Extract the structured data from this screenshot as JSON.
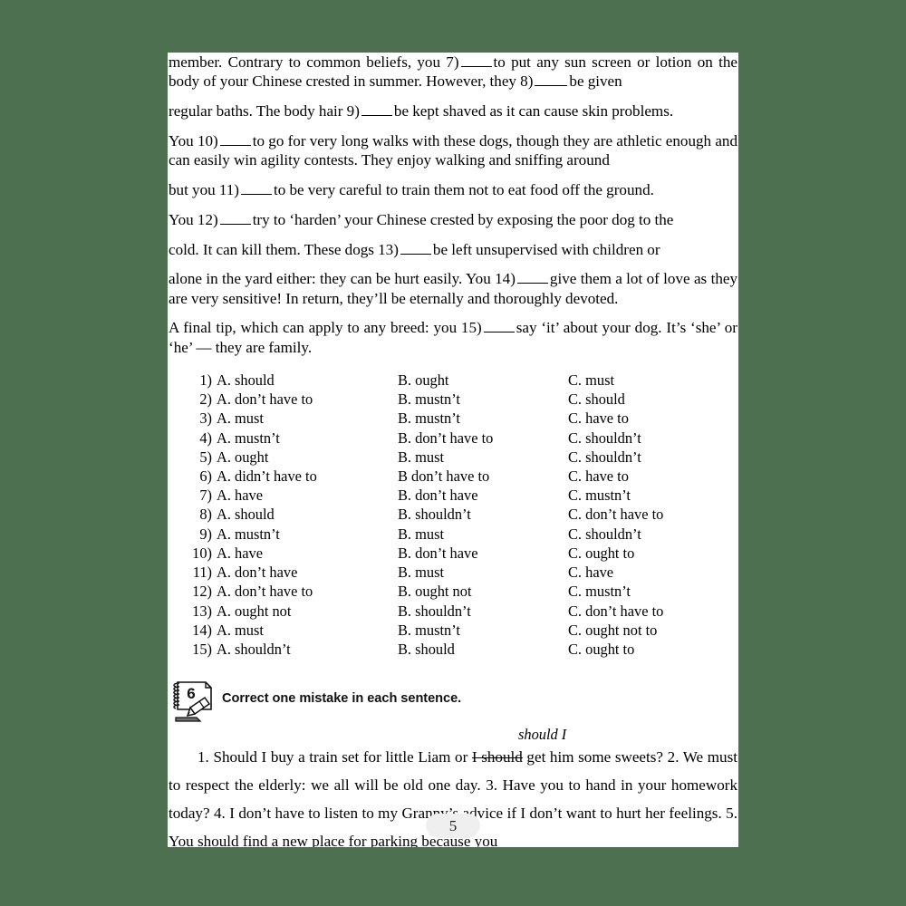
{
  "page": {
    "background_color": "#4c7050",
    "sheet_color": "#ffffff",
    "page_number": "5",
    "page_number_pill_color": "#efefef"
  },
  "passage": {
    "paragraphs": [
      {
        "id": "p1",
        "segments": [
          {
            "type": "text",
            "value": "member. Contrary to common beliefs, you 7)"
          },
          {
            "type": "blank"
          },
          {
            "type": "text",
            "value": "to put any sun screen or lotion on the body of your Chinese crested in summer. However, they 8)"
          },
          {
            "type": "blank"
          },
          {
            "type": "text",
            "value": "be given"
          }
        ]
      },
      {
        "id": "p2",
        "segments": [
          {
            "type": "text",
            "value": "regular baths. The body hair 9)"
          },
          {
            "type": "blank"
          },
          {
            "type": "text",
            "value": "be kept shaved as it can cause skin problems."
          }
        ]
      },
      {
        "id": "p3",
        "segments": [
          {
            "type": "text",
            "value": "You 10)"
          },
          {
            "type": "blank"
          },
          {
            "type": "text",
            "value": "to go for very long walks with these dogs, though they are athletic enough and can easily win agility contests. They enjoy walking and sniffing around"
          }
        ]
      },
      {
        "id": "p4",
        "segments": [
          {
            "type": "text",
            "value": "but you 11)"
          },
          {
            "type": "blank"
          },
          {
            "type": "text",
            "value": "to be very careful to train them not to eat food off the ground."
          }
        ]
      },
      {
        "id": "p5",
        "segments": [
          {
            "type": "text",
            "value": "You 12)"
          },
          {
            "type": "blank"
          },
          {
            "type": "text",
            "value": "try to ‘harden’ your Chinese crested by exposing the poor dog to the"
          }
        ]
      },
      {
        "id": "p6",
        "segments": [
          {
            "type": "text",
            "value": "cold. It can kill them. These dogs 13)"
          },
          {
            "type": "blank"
          },
          {
            "type": "text",
            "value": "be left unsupervised with children or"
          }
        ]
      },
      {
        "id": "p7",
        "segments": [
          {
            "type": "text",
            "value": "alone in the yard either: they can be hurt easily. You 14)"
          },
          {
            "type": "blank"
          },
          {
            "type": "text",
            "value": "give them a lot of love as they are very sensitive! In return, they’ll be eternally and thoroughly devoted."
          }
        ]
      },
      {
        "id": "p8",
        "segments": [
          {
            "type": "text",
            "value": "A final tip, which can apply to any breed: you 15)"
          },
          {
            "type": "blank"
          },
          {
            "type": "text",
            "value": "say ‘it’ about your dog. It’s ‘she’ or ‘he’ — they are family."
          }
        ]
      }
    ]
  },
  "options": [
    {
      "num": "1)",
      "a": "A. should",
      "b": "B. ought",
      "c": "C. must"
    },
    {
      "num": "2)",
      "a": "A. don’t have to",
      "b": "B. mustn’t",
      "c": "C. should"
    },
    {
      "num": "3)",
      "a": "A. must",
      "b": "B. mustn’t",
      "c": "C. have to"
    },
    {
      "num": "4)",
      "a": "A. mustn’t",
      "b": "B. don’t have to",
      "c": "C. shouldn’t"
    },
    {
      "num": "5)",
      "a": "A. ought",
      "b": "B. must",
      "c": "C. shouldn’t"
    },
    {
      "num": "6)",
      "a": "A. didn’t have to",
      "b": "B don’t have to",
      "c": "C. have to"
    },
    {
      "num": "7)",
      "a": "A. have",
      "b": "B. don’t have",
      "c": "C. mustn’t"
    },
    {
      "num": "8)",
      "a": "A. should",
      "b": "B. shouldn’t",
      "c": "C. don’t have to"
    },
    {
      "num": "9)",
      "a": "A. mustn’t",
      "b": "B. must",
      "c": "C. shouldn’t"
    },
    {
      "num": "10)",
      "a": "A. have",
      "b": "B. don’t have",
      "c": "C. ought to"
    },
    {
      "num": "11)",
      "a": "A. don’t have",
      "b": "B. must",
      "c": "C. have"
    },
    {
      "num": "12)",
      "a": "A. don’t have to",
      "b": "B. ought not",
      "c": "C. mustn’t"
    },
    {
      "num": "13)",
      "a": "A. ought not",
      "b": "B. shouldn’t",
      "c": "C. don’t have to"
    },
    {
      "num": "14)",
      "a": "A. must",
      "b": "B. mustn’t",
      "c": "C. ought not to"
    },
    {
      "num": "15)",
      "a": "A. shouldn’t",
      "b": "B. should",
      "c": "C. ought to"
    }
  ],
  "exercise": {
    "number": "6",
    "icon": "notepad-pencil-icon",
    "instruction": "Correct one mistake in each sentence.",
    "annotation": "should I",
    "sentences": {
      "lead_number": "1.",
      "before_strike": "Should I buy a train set for little Liam or ",
      "strike_text": "I should",
      "after_strike": " get him some sweets?",
      "rest": "2. We must to respect the elderly: we all will be old one day. 3. Have you to hand in your homework today? 4. I don’t have to listen to my Granny’s advice if I don’t want to hurt her feelings. 5. You should find a new place for parking because you"
    }
  }
}
